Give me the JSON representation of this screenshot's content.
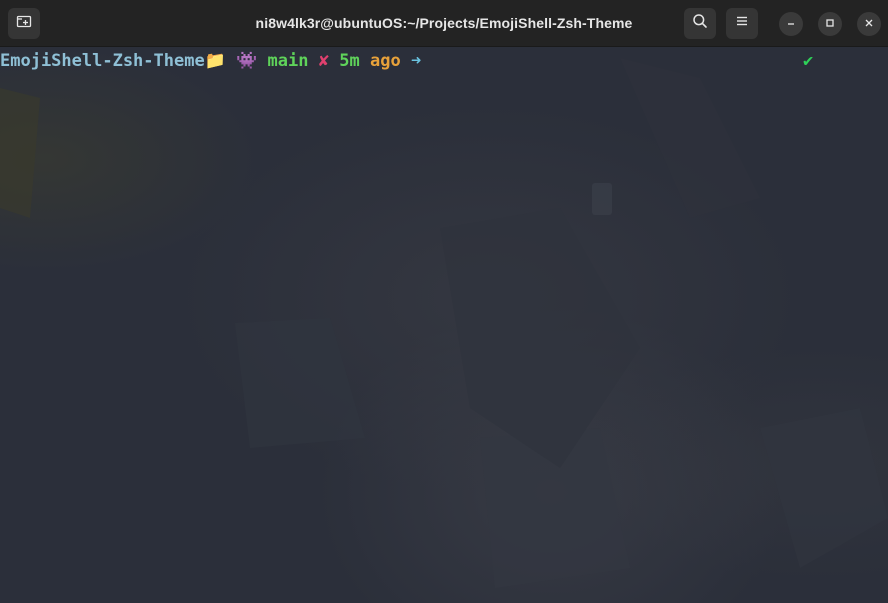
{
  "window": {
    "title": "ni8w4lk3r@ubuntuOS:~/Projects/EmojiShell-Zsh-Theme"
  },
  "header": {
    "new_tab_icon": "new-tab-icon",
    "search_icon": "search-icon",
    "menu_icon": "hamburger-menu-icon",
    "minimize_icon": "minimize-icon",
    "maximize_icon": "maximize-icon",
    "close_icon": "close-icon"
  },
  "prompt": {
    "directory": "EmojiShell-Zsh-Theme",
    "folder_glyph": "📁",
    "alien_glyph": "👾",
    "branch": "main",
    "dirty_glyph": "✘",
    "time_value": "5m",
    "time_suffix": "ago",
    "arrow_glyph": "➜",
    "status_glyph": "✔"
  },
  "colors": {
    "directory": "#8fc0d6",
    "branch": "#5fd35a",
    "dirty": "#e0406e",
    "time_suffix": "#e8a23a",
    "arrow": "#6ac3e0",
    "status_ok": "#2ed158",
    "terminal_bg": "#2b2f3a",
    "titlebar_bg": "#232323"
  }
}
